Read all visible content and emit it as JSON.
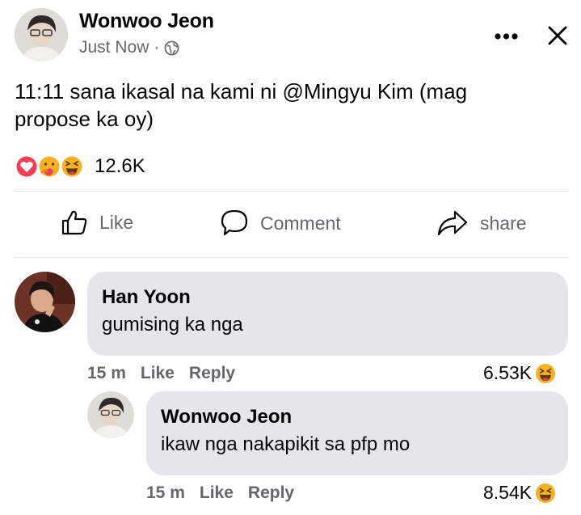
{
  "post": {
    "author": "Wonwoo Jeon",
    "time": "Just Now",
    "separator": "·",
    "text": "11:11 sana ikasal na kami ni @Mingyu Kim (mag propose ka oy)",
    "reaction_count": "12.6K"
  },
  "actions": {
    "like": "Like",
    "comment": "Comment",
    "share": "share"
  },
  "comments": [
    {
      "name": "Han Yoon",
      "text": "gumising ka nga",
      "time": "15 m",
      "like": "Like",
      "reply": "Reply",
      "reactions": "6.53K"
    },
    {
      "name": "Wonwoo Jeon",
      "text": "ikaw nga nakapikit sa pfp mo",
      "time": "15 m",
      "like": "Like",
      "reply": "Reply",
      "reactions": "8.54K"
    }
  ],
  "colors": {
    "meta_gray": "#65676b",
    "bubble": "#e4e6eb",
    "love": "#f33e58",
    "haha": "#f7b125"
  }
}
